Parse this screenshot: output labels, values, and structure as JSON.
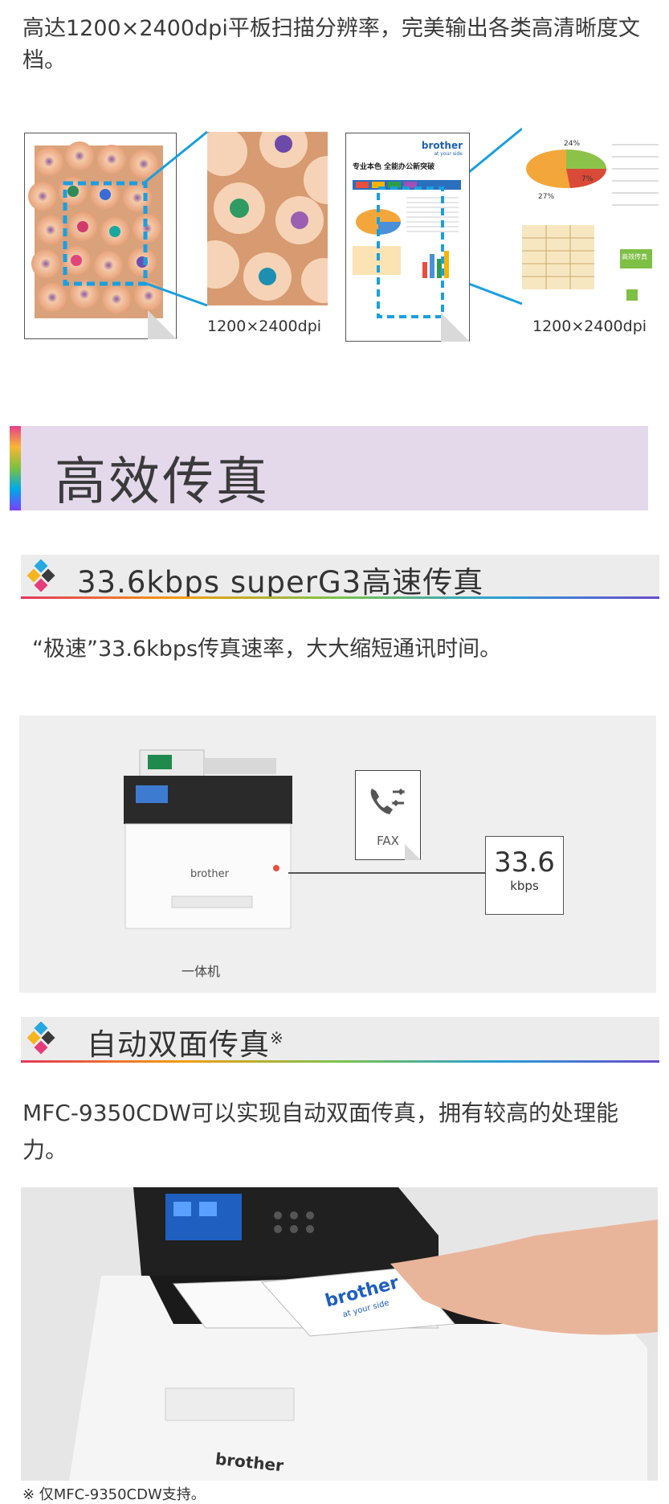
{
  "scan": {
    "intro": "高达1200×2400dpi平板扫描分辨率，完美输出各类高清晰度文档。",
    "caption_left": "1200×2400dpi",
    "caption_right": "1200×2400dpi",
    "doc_logo": "brother",
    "doc_logo_tag": "at your side",
    "doc_heading": "专业本色 全能办公新突破",
    "doc_side_numbers": [
      "24%",
      "7%",
      "27%"
    ],
    "doc_side_label": "高效传真",
    "doc_pct": "27%"
  },
  "fax_section": {
    "title": "高效传真"
  },
  "speed": {
    "heading": "33.6kbps superG3高速传真",
    "body": "“极速”33.6kbps传真速率，大大缩短通讯时间。",
    "device_label": "一体机",
    "brand": "brother",
    "fax_label": "FAX",
    "speed_value": "33.6",
    "speed_unit": "kbps"
  },
  "duplex": {
    "heading": "自动双面传真",
    "heading_mark": "※",
    "body": "MFC-9350CDW可以实现自动双面传真，拥有较高的处理能力。",
    "paper_brand": "brother",
    "paper_tag": "at your side",
    "printer_brand": "brother",
    "note": "※ 仅MFC-9350CDW支持。"
  },
  "colors": {
    "accent_blue": "#1a9fe0",
    "band": "#e4d9ea",
    "bar": "#ececec"
  }
}
